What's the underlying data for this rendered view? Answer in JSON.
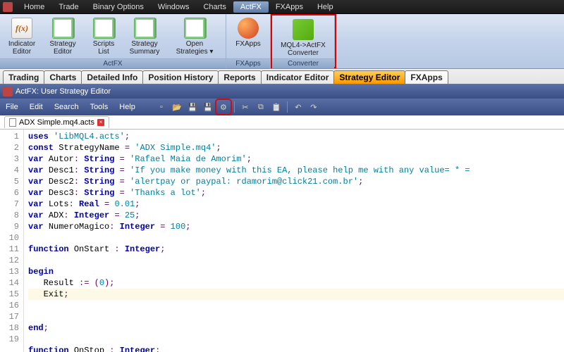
{
  "menubar": [
    "Home",
    "Trade",
    "Binary Options",
    "Windows",
    "Charts",
    "ActFX",
    "FXApps",
    "Help"
  ],
  "menubar_active_index": 5,
  "ribbon": {
    "groups": [
      {
        "label": "ActFX",
        "buttons": [
          {
            "label": "Indicator\nEditor",
            "icon": "fx"
          },
          {
            "label": "Strategy\nEditor",
            "icon": "page"
          },
          {
            "label": "Scripts\nList",
            "icon": "page"
          },
          {
            "label": "Strategy\nSummary",
            "icon": "page"
          },
          {
            "label": "Open\nStrategies ▾",
            "icon": "page",
            "wide": true
          }
        ]
      },
      {
        "label": "FXApps",
        "buttons": [
          {
            "label": "FXApps",
            "icon": "ball"
          }
        ]
      },
      {
        "label": "Converter",
        "highlight": true,
        "buttons": [
          {
            "label": "MQL4->ActFX\nConverter",
            "icon": "arrows",
            "wide": true
          }
        ]
      }
    ]
  },
  "tabs": [
    "Trading",
    "Charts",
    "Detailed Info",
    "Position History",
    "Reports",
    "Indicator Editor",
    "Strategy Editor",
    "FXApps"
  ],
  "tabs_active_index": 6,
  "subwindow_title": "ActFX: User Strategy Editor",
  "ed_menu": [
    "File",
    "Edit",
    "Search",
    "Tools",
    "Help"
  ],
  "file_tab": "ADX Simple.mq4.acts",
  "toolbar_icons": [
    "new-icon",
    "open-icon",
    "save-icon",
    "saveall-icon",
    "compile-icon",
    "sep",
    "cut-icon",
    "copy-icon",
    "paste-icon",
    "sep",
    "undo-icon",
    "redo-icon"
  ],
  "toolbar_highlight_index": 4,
  "current_line": 15,
  "code_lines": [
    {
      "n": 1,
      "tokens": [
        [
          "kw",
          "uses "
        ],
        [
          "str",
          "'LibMQL4.acts'"
        ],
        [
          "op",
          ";"
        ]
      ]
    },
    {
      "n": 2,
      "tokens": [
        [
          "kw",
          "const "
        ],
        [
          "nm",
          "StrategyName "
        ],
        [
          "op",
          "= "
        ],
        [
          "str",
          "'ADX Simple.mq4'"
        ],
        [
          "op",
          ";"
        ]
      ]
    },
    {
      "n": 3,
      "tokens": [
        [
          "kw",
          "var "
        ],
        [
          "nm",
          "Autor"
        ],
        [
          "op",
          ": "
        ],
        [
          "ty",
          "String"
        ],
        [
          "op",
          " = "
        ],
        [
          "str",
          "'Rafael Maia de Amorim'"
        ],
        [
          "op",
          ";"
        ]
      ]
    },
    {
      "n": 4,
      "tokens": [
        [
          "kw",
          "var "
        ],
        [
          "nm",
          "Desc1"
        ],
        [
          "op",
          ": "
        ],
        [
          "ty",
          "String"
        ],
        [
          "op",
          " = "
        ],
        [
          "str",
          "'If you make money with this EA, please help me with any value= * ="
        ],
        [
          "op",
          ""
        ]
      ]
    },
    {
      "n": 5,
      "tokens": [
        [
          "kw",
          "var "
        ],
        [
          "nm",
          "Desc2"
        ],
        [
          "op",
          ": "
        ],
        [
          "ty",
          "String"
        ],
        [
          "op",
          " = "
        ],
        [
          "str",
          "'alertpay or paypal: rdamorim@click21.com.br'"
        ],
        [
          "op",
          ";"
        ]
      ]
    },
    {
      "n": 6,
      "tokens": [
        [
          "kw",
          "var "
        ],
        [
          "nm",
          "Desc3"
        ],
        [
          "op",
          ": "
        ],
        [
          "ty",
          "String"
        ],
        [
          "op",
          " = "
        ],
        [
          "str",
          "'Thanks a lot'"
        ],
        [
          "op",
          ";"
        ]
      ]
    },
    {
      "n": 7,
      "tokens": [
        [
          "kw",
          "var "
        ],
        [
          "nm",
          "Lots"
        ],
        [
          "op",
          ": "
        ],
        [
          "ty",
          "Real"
        ],
        [
          "op",
          " = "
        ],
        [
          "num",
          "0.01"
        ],
        [
          "op",
          ";"
        ]
      ]
    },
    {
      "n": 8,
      "tokens": [
        [
          "kw",
          "var "
        ],
        [
          "nm",
          "ADX"
        ],
        [
          "op",
          ": "
        ],
        [
          "ty",
          "Integer"
        ],
        [
          "op",
          " = "
        ],
        [
          "num",
          "25"
        ],
        [
          "op",
          ";"
        ]
      ]
    },
    {
      "n": 9,
      "tokens": [
        [
          "kw",
          "var "
        ],
        [
          "nm",
          "NumeroMagico"
        ],
        [
          "op",
          ": "
        ],
        [
          "ty",
          "Integer"
        ],
        [
          "op",
          " = "
        ],
        [
          "num",
          "100"
        ],
        [
          "op",
          ";"
        ]
      ]
    },
    {
      "n": 10,
      "tokens": []
    },
    {
      "n": 11,
      "tokens": [
        [
          "kw",
          "function "
        ],
        [
          "nm",
          "OnStart "
        ],
        [
          "op",
          ": "
        ],
        [
          "ty",
          "Integer"
        ],
        [
          "op",
          ";"
        ]
      ]
    },
    {
      "n": 12,
      "tokens": []
    },
    {
      "n": 13,
      "tokens": [
        [
          "kw",
          "begin"
        ]
      ]
    },
    {
      "n": 14,
      "tokens": [
        [
          "nm",
          "   Result "
        ],
        [
          "op",
          ":= ("
        ],
        [
          "num",
          "0"
        ],
        [
          "op",
          ");"
        ]
      ]
    },
    {
      "n": 15,
      "tokens": [
        [
          "nm",
          "   Exit"
        ],
        [
          "op",
          ";"
        ]
      ]
    },
    {
      "n": 16,
      "tokens": []
    },
    {
      "n": 17,
      "tokens": [
        [
          "kw",
          "end"
        ],
        [
          "op",
          ";"
        ]
      ]
    },
    {
      "n": 18,
      "tokens": []
    },
    {
      "n": 19,
      "tokens": [
        [
          "kw",
          "function "
        ],
        [
          "nm",
          "OnStop "
        ],
        [
          "op",
          ": "
        ],
        [
          "ty",
          "Integer"
        ],
        [
          "op",
          ";"
        ]
      ]
    }
  ]
}
